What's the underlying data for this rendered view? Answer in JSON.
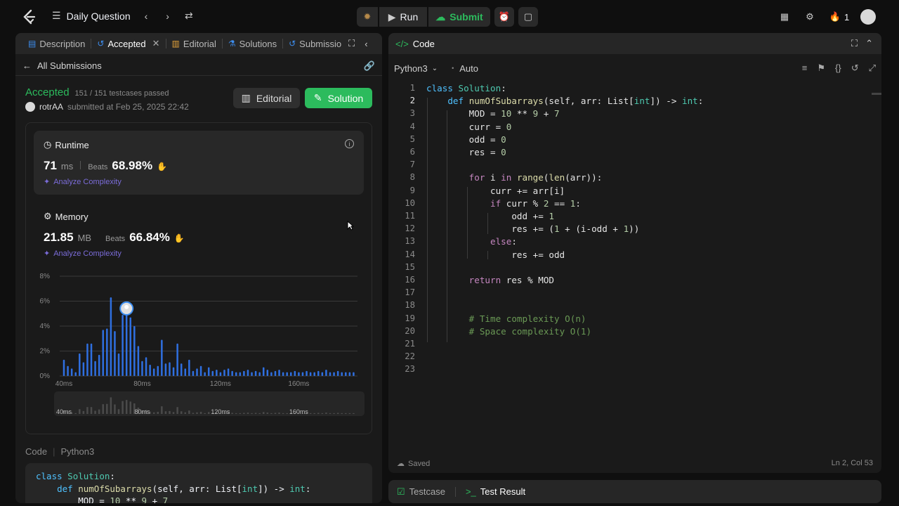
{
  "topbar": {
    "daily_question": "Daily Question",
    "run": "Run",
    "submit": "Submit",
    "streak": "1"
  },
  "left": {
    "tabs": [
      {
        "label": "Description"
      },
      {
        "label": "Accepted"
      },
      {
        "label": "Editorial"
      },
      {
        "label": "Solutions"
      },
      {
        "label": "Submissio"
      }
    ],
    "all_submissions": "All Submissions",
    "status": "Accepted",
    "testcases": "151 / 151 testcases passed",
    "user": "rotrAA",
    "submitted_at": "submitted at Feb 25, 2025 22:42",
    "editorial_btn": "Editorial",
    "solution_btn": "Solution",
    "runtime": {
      "title": "Runtime",
      "value": "71",
      "unit": "ms",
      "beats_label": "Beats",
      "beats": "68.98%",
      "analyze": "Analyze Complexity"
    },
    "memory": {
      "title": "Memory",
      "value": "21.85",
      "unit": "MB",
      "beats_label": "Beats",
      "beats": "66.84%",
      "analyze": "Analyze Complexity"
    },
    "code_label": "Code",
    "code_lang": "Python3",
    "code_preview": [
      "class Solution:",
      "    def numOfSubarrays(self, arr: List[int]) -> int:",
      "        MOD = 10 ** 9 + 7"
    ]
  },
  "chart_data": {
    "type": "bar",
    "ylim": [
      0,
      8
    ],
    "yticks": [
      "8%",
      "6%",
      "4%",
      "2%",
      "0%"
    ],
    "xticks": [
      "40ms",
      "80ms",
      "120ms",
      "160ms"
    ],
    "xrange": [
      40,
      190
    ],
    "x": [
      40,
      42,
      44,
      46,
      48,
      50,
      52,
      54,
      56,
      58,
      60,
      62,
      64,
      66,
      68,
      70,
      72,
      74,
      76,
      78,
      80,
      82,
      84,
      86,
      88,
      90,
      92,
      94,
      96,
      98,
      100,
      102,
      104,
      106,
      108,
      110,
      112,
      114,
      116,
      118,
      120,
      122,
      124,
      126,
      128,
      130,
      132,
      134,
      136,
      138,
      140,
      142,
      144,
      146,
      148,
      150,
      152,
      154,
      156,
      158,
      160,
      162,
      164,
      166,
      168,
      170,
      172,
      174,
      176,
      178,
      180,
      182,
      184,
      186,
      188
    ],
    "values": [
      1.3,
      0.8,
      0.6,
      0.3,
      1.8,
      1.1,
      2.6,
      2.6,
      1.2,
      1.7,
      3.7,
      3.8,
      6.3,
      3.6,
      1.8,
      4.9,
      5.3,
      4.7,
      4.0,
      2.4,
      1.2,
      1.5,
      0.9,
      0.6,
      0.8,
      2.9,
      1.0,
      1.1,
      0.7,
      2.6,
      1.0,
      0.6,
      1.3,
      0.4,
      0.6,
      0.8,
      0.3,
      0.7,
      0.4,
      0.5,
      0.3,
      0.5,
      0.6,
      0.4,
      0.3,
      0.3,
      0.4,
      0.5,
      0.3,
      0.4,
      0.3,
      0.7,
      0.5,
      0.3,
      0.4,
      0.5,
      0.3,
      0.3,
      0.3,
      0.4,
      0.3,
      0.3,
      0.4,
      0.3,
      0.3,
      0.4,
      0.3,
      0.5,
      0.3,
      0.3,
      0.4,
      0.3,
      0.3,
      0.3,
      0.3
    ],
    "highlight_x": 72,
    "color": "#2f6fe0"
  },
  "right": {
    "title": "Code",
    "lang": "Python3",
    "auto": "Auto",
    "saved": "Saved",
    "cursor_pos": "Ln 2, Col 53",
    "testcase": "Testcase",
    "test_result": "Test Result"
  }
}
